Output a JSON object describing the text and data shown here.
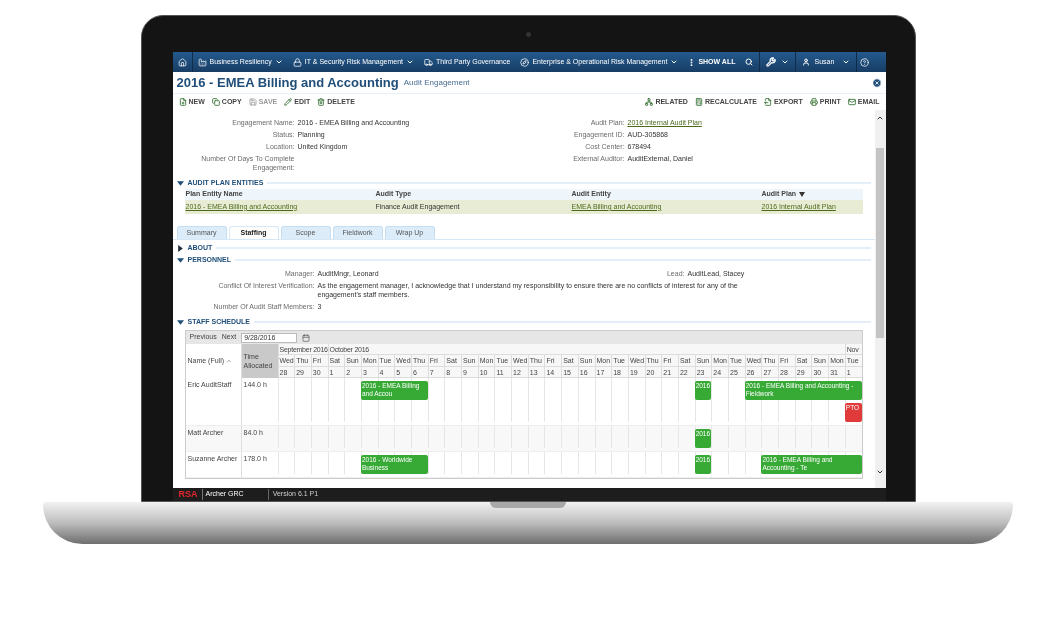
{
  "nav": {
    "items": [
      {
        "label": "Business Resiliency",
        "kind": "factory",
        "dropdown": true
      },
      {
        "label": "IT & Security Risk Management",
        "kind": "lock",
        "dropdown": true
      },
      {
        "label": "Third Party Governance",
        "kind": "truck",
        "dropdown": false
      },
      {
        "label": "Enterprise & Operational Risk Management",
        "kind": "compass",
        "dropdown": true
      }
    ],
    "show_all": "SHOW ALL",
    "user": "Susan"
  },
  "record": {
    "title": "2016 - EMEA Billing and Accounting",
    "subtitle": "Audit Engagement"
  },
  "toolbar": {
    "left": [
      {
        "label": "NEW",
        "kind": "new",
        "disabled": false
      },
      {
        "label": "COPY",
        "kind": "copy",
        "disabled": false
      },
      {
        "label": "SAVE",
        "kind": "save",
        "disabled": true
      },
      {
        "label": "EDIT",
        "kind": "edit",
        "disabled": false
      },
      {
        "label": "DELETE",
        "kind": "delete",
        "disabled": false
      }
    ],
    "right": [
      {
        "label": "RELATED",
        "kind": "related",
        "disabled": false
      },
      {
        "label": "RECALCULATE",
        "kind": "recalculate",
        "disabled": false
      },
      {
        "label": "EXPORT",
        "kind": "export",
        "disabled": false
      },
      {
        "label": "PRINT",
        "kind": "print",
        "disabled": false
      },
      {
        "label": "EMAIL",
        "kind": "email",
        "disabled": false
      }
    ]
  },
  "fields": {
    "left": [
      {
        "label": "Engagement Name:",
        "value": "2016 - EMEA Billing and Accounting",
        "link": false
      },
      {
        "label": "Status:",
        "value": "Planning",
        "link": false
      },
      {
        "label": "Location:",
        "value": "United Kingdom",
        "link": false
      },
      {
        "label": "Number Of Days To Complete Engagement:"
      }
    ],
    "right": [
      {
        "label": "Audit Plan:",
        "value": "2016 Internal Audit Plan",
        "link": true
      },
      {
        "label": "Engagement ID:",
        "value": "AUD-305868",
        "link": false
      },
      {
        "label": "Cost Center:",
        "value": "678494",
        "link": false
      },
      {
        "label": "External Auditor:",
        "value": "AuditExternal, Daniel",
        "link": false
      }
    ]
  },
  "audit_plan_entities": {
    "title": "AUDIT PLAN ENTITIES",
    "expanded": true,
    "columns": [
      {
        "label": "Plan Entity Name",
        "sorted": false
      },
      {
        "label": "Audit Type",
        "sorted": false
      },
      {
        "label": "Audit Entity",
        "sorted": false
      },
      {
        "label": "Audit Plan",
        "sorted": true
      }
    ],
    "rows": [
      {
        "selected": true,
        "cells": [
          {
            "text": "2016 - EMEA Billing and Accounting",
            "link": true
          },
          {
            "text": "Finance Audit Engagement",
            "link": false
          },
          {
            "text": "EMEA Billing and Accounting",
            "link": true
          },
          {
            "text": "2016 Internal Audit Plan",
            "link": true
          }
        ]
      }
    ]
  },
  "tabs": [
    {
      "label": "Summary",
      "selected": false
    },
    {
      "label": "Staffing",
      "selected": true
    },
    {
      "label": "Scope",
      "selected": false
    },
    {
      "label": "Fieldwork",
      "selected": false
    },
    {
      "label": "Wrap Up",
      "selected": false
    }
  ],
  "about": {
    "title": "ABOUT",
    "expanded": false
  },
  "personnel": {
    "title": "PERSONNEL",
    "expanded": true,
    "manager": {
      "label": "Manager:",
      "value": "AuditMngr, Leonard"
    },
    "lead": {
      "label": "Lead:",
      "value": "AuditLead, Stacey"
    },
    "conflict": {
      "label": "Conflict Of Interest Verification:",
      "value": "As the engagement manager, I acknowledge that I understand my responsibility to ensure there are no conflicts of interest for any of the engagement's staff members."
    },
    "staff_count": {
      "label": "Number Of Audit Staff Members:",
      "value": "3"
    }
  },
  "staff_schedule": {
    "title": "STAFF SCHEDULE",
    "expanded": true,
    "previous": "Previous",
    "next": "Next",
    "date": "9/28/2016",
    "name_column": "Name (Full)",
    "time_column": "Time Allocated",
    "months": [
      {
        "label": "September 2016",
        "days": [
          {
            "dow": "Wed",
            "date": "28"
          },
          {
            "dow": "Thu",
            "date": "29"
          },
          {
            "dow": "Fri",
            "date": "30"
          }
        ]
      },
      {
        "label": "October 2016",
        "days": [
          {
            "dow": "Sat",
            "date": "1"
          },
          {
            "dow": "Sun",
            "date": "2"
          },
          {
            "dow": "Mon",
            "date": "3"
          },
          {
            "dow": "Tue",
            "date": "4"
          },
          {
            "dow": "Wed",
            "date": "5"
          },
          {
            "dow": "Thu",
            "date": "6"
          },
          {
            "dow": "Fri",
            "date": "7"
          },
          {
            "dow": "Sat",
            "date": "8"
          },
          {
            "dow": "Sun",
            "date": "9"
          },
          {
            "dow": "Mon",
            "date": "10"
          },
          {
            "dow": "Tue",
            "date": "11"
          },
          {
            "dow": "Wed",
            "date": "12"
          },
          {
            "dow": "Thu",
            "date": "13"
          },
          {
            "dow": "Fri",
            "date": "14"
          },
          {
            "dow": "Sat",
            "date": "15"
          },
          {
            "dow": "Sun",
            "date": "16"
          },
          {
            "dow": "Mon",
            "date": "17"
          },
          {
            "dow": "Tue",
            "date": "18"
          },
          {
            "dow": "Wed",
            "date": "19"
          },
          {
            "dow": "Thu",
            "date": "20"
          },
          {
            "dow": "Fri",
            "date": "21"
          },
          {
            "dow": "Sat",
            "date": "22"
          },
          {
            "dow": "Sun",
            "date": "23"
          },
          {
            "dow": "Mon",
            "date": "24"
          },
          {
            "dow": "Tue",
            "date": "25"
          },
          {
            "dow": "Wed",
            "date": "26"
          },
          {
            "dow": "Thu",
            "date": "27"
          },
          {
            "dow": "Fri",
            "date": "28"
          },
          {
            "dow": "Sat",
            "date": "29"
          },
          {
            "dow": "Sun",
            "date": "30"
          },
          {
            "dow": "Mon",
            "date": "31"
          }
        ]
      },
      {
        "label": "Nov",
        "days": [
          {
            "dow": "Tue",
            "date": "1"
          }
        ]
      }
    ],
    "rows": [
      {
        "name": "Eric AuditStaff",
        "time": "144.0 h",
        "lanes": [
          [
            {
              "kind": "empty"
            },
            {
              "kind": "empty"
            },
            {
              "kind": "empty"
            },
            {
              "kind": "empty"
            },
            {
              "kind": "empty"
            },
            {
              "kind": "assignment",
              "label": "2016 - EMEA Billing and Accou"
            },
            {
              "kind": "continued"
            },
            {
              "kind": "continued"
            },
            {
              "kind": "continued"
            },
            {
              "kind": "empty"
            },
            {
              "kind": "empty"
            },
            {
              "kind": "empty"
            },
            {
              "kind": "empty"
            },
            {
              "kind": "empty"
            },
            {
              "kind": "empty"
            },
            {
              "kind": "empty"
            },
            {
              "kind": "empty"
            },
            {
              "kind": "empty"
            },
            {
              "kind": "empty"
            },
            {
              "kind": "empty"
            },
            {
              "kind": "empty"
            },
            {
              "kind": "empty"
            },
            {
              "kind": "empty"
            },
            {
              "kind": "empty"
            },
            {
              "kind": "empty"
            },
            {
              "kind": "assignment",
              "label": "2016"
            },
            {
              "kind": "empty"
            },
            {
              "kind": "empty"
            },
            {
              "kind": "assignment",
              "label": "2016 - EMEA Billing and Accounting - Fieldwork"
            },
            {
              "kind": "continued"
            },
            {
              "kind": "continued"
            },
            {
              "kind": "continued"
            },
            {
              "kind": "continued"
            },
            {
              "kind": "continued"
            },
            {
              "kind": "continued"
            }
          ],
          [
            {
              "kind": "empty"
            },
            {
              "kind": "empty"
            },
            {
              "kind": "empty"
            },
            {
              "kind": "empty"
            },
            {
              "kind": "empty"
            },
            {
              "kind": "empty"
            },
            {
              "kind": "empty"
            },
            {
              "kind": "empty"
            },
            {
              "kind": "empty"
            },
            {
              "kind": "empty"
            },
            {
              "kind": "empty"
            },
            {
              "kind": "empty"
            },
            {
              "kind": "empty"
            },
            {
              "kind": "empty"
            },
            {
              "kind": "empty"
            },
            {
              "kind": "empty"
            },
            {
              "kind": "empty"
            },
            {
              "kind": "empty"
            },
            {
              "kind": "empty"
            },
            {
              "kind": "empty"
            },
            {
              "kind": "empty"
            },
            {
              "kind": "empty"
            },
            {
              "kind": "empty"
            },
            {
              "kind": "empty"
            },
            {
              "kind": "empty"
            },
            {
              "kind": "empty"
            },
            {
              "kind": "empty"
            },
            {
              "kind": "empty"
            },
            {
              "kind": "empty"
            },
            {
              "kind": "empty"
            },
            {
              "kind": "empty"
            },
            {
              "kind": "empty"
            },
            {
              "kind": "empty"
            },
            {
              "kind": "empty"
            },
            {
              "kind": "time_off",
              "label": "PTO"
            }
          ]
        ]
      },
      {
        "name": "Matt Archer",
        "time": "84.0 h",
        "lanes": [
          [
            {
              "kind": "empty"
            },
            {
              "kind": "empty"
            },
            {
              "kind": "empty"
            },
            {
              "kind": "empty"
            },
            {
              "kind": "empty"
            },
            {
              "kind": "empty"
            },
            {
              "kind": "empty"
            },
            {
              "kind": "empty"
            },
            {
              "kind": "empty"
            },
            {
              "kind": "empty"
            },
            {
              "kind": "empty"
            },
            {
              "kind": "empty"
            },
            {
              "kind": "empty"
            },
            {
              "kind": "empty"
            },
            {
              "kind": "empty"
            },
            {
              "kind": "empty"
            },
            {
              "kind": "empty"
            },
            {
              "kind": "empty"
            },
            {
              "kind": "empty"
            },
            {
              "kind": "empty"
            },
            {
              "kind": "empty"
            },
            {
              "kind": "empty"
            },
            {
              "kind": "empty"
            },
            {
              "kind": "empty"
            },
            {
              "kind": "empty"
            },
            {
              "kind": "assignment",
              "label": "2016"
            },
            {
              "kind": "empty"
            },
            {
              "kind": "empty"
            },
            {
              "kind": "empty"
            },
            {
              "kind": "empty"
            },
            {
              "kind": "empty"
            },
            {
              "kind": "empty"
            },
            {
              "kind": "empty"
            },
            {
              "kind": "empty"
            },
            {
              "kind": "empty"
            }
          ]
        ]
      },
      {
        "name": "Suzanne Archer",
        "time": "178.0 h",
        "lanes": [
          [
            {
              "kind": "empty"
            },
            {
              "kind": "empty"
            },
            {
              "kind": "empty"
            },
            {
              "kind": "empty"
            },
            {
              "kind": "empty"
            },
            {
              "kind": "assignment",
              "label": "2016 - Worldwide Business"
            },
            {
              "kind": "continued"
            },
            {
              "kind": "continued"
            },
            {
              "kind": "continued"
            },
            {
              "kind": "empty"
            },
            {
              "kind": "empty"
            },
            {
              "kind": "empty"
            },
            {
              "kind": "empty"
            },
            {
              "kind": "empty"
            },
            {
              "kind": "empty"
            },
            {
              "kind": "empty"
            },
            {
              "kind": "empty"
            },
            {
              "kind": "empty"
            },
            {
              "kind": "empty"
            },
            {
              "kind": "empty"
            },
            {
              "kind": "empty"
            },
            {
              "kind": "empty"
            },
            {
              "kind": "empty"
            },
            {
              "kind": "empty"
            },
            {
              "kind": "empty"
            },
            {
              "kind": "assignment",
              "label": "2016"
            },
            {
              "kind": "empty"
            },
            {
              "kind": "empty"
            },
            {
              "kind": "empty"
            },
            {
              "kind": "assignment",
              "label": "2016 - EMEA Billing and Accounting - Te"
            },
            {
              "kind": "continued"
            },
            {
              "kind": "continued"
            },
            {
              "kind": "continued"
            },
            {
              "kind": "continued"
            },
            {
              "kind": "continued"
            }
          ]
        ]
      }
    ]
  },
  "footer": {
    "logo": "RSA",
    "product": "Archer GRC",
    "version": "Version 6.1 P1"
  }
}
